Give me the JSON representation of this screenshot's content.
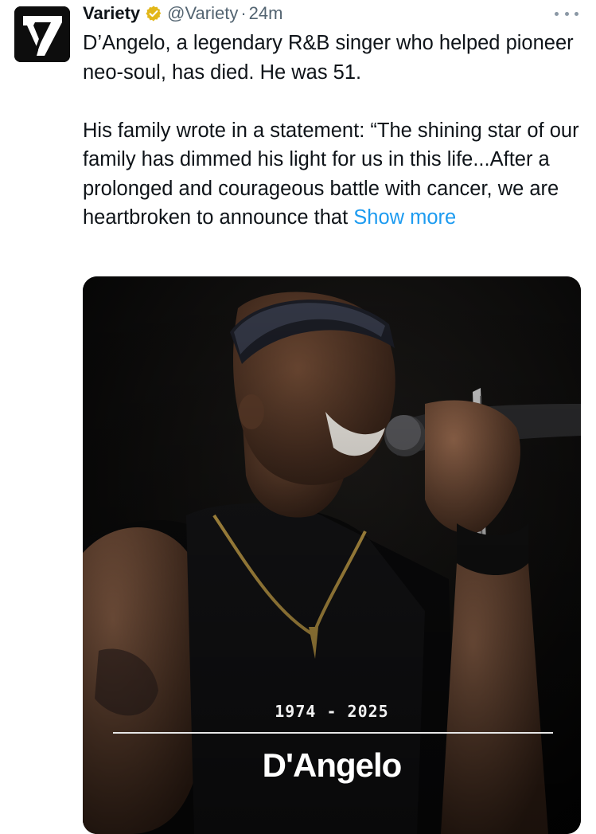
{
  "author": {
    "name": "Variety",
    "handle": "@Variety",
    "separator": "·",
    "time": "24m",
    "avatar_icon": "variety-v-logo",
    "verified_icon": "gold-verified-badge",
    "verified_color": "#e2b719"
  },
  "more_icon": "ellipsis-icon",
  "tweet": {
    "paragraph1": "D’Angelo, a legendary R&B singer who helped pioneer neo-soul, has died. He was 51.",
    "paragraph2": "His family wrote in a statement: “The shining star of our family has dimmed his light for us in this life...After a prolonged and courageous battle with cancer, we are heartbroken to announce that",
    "show_more": "Show more",
    "link_color": "#1d9bf0"
  },
  "media": {
    "years": "1974 - 2025",
    "name": "D'Angelo"
  }
}
